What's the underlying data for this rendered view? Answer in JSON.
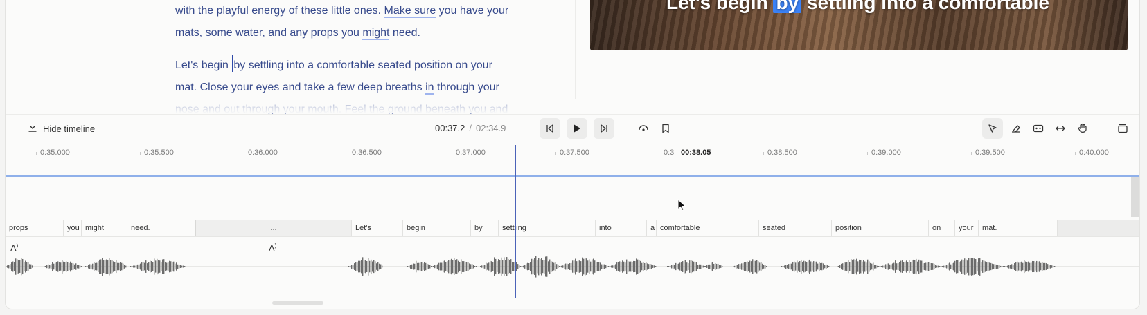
{
  "transcript": {
    "lines": [
      {
        "pre": "with the playful energy of these little ones. ",
        "ul": "Make sure",
        "post": " you have your"
      },
      {
        "pre": "mats, some water, and any props you ",
        "ul": "might",
        "post": " need."
      }
    ],
    "p2": {
      "l1_pre": "Let's begin ",
      "l1_post": "by settling into a comfortable seated position on your",
      "l2_pre": "mat. Close your eyes and take a few deep breaths ",
      "l2_ul": "in",
      "l2_post": " through your",
      "l3": "nose and out through your mouth. Feel the ground beneath you and"
    }
  },
  "video": {
    "caption_pre": "Let's begin ",
    "caption_hl": "by",
    "caption_post": " settling into a comfortable"
  },
  "toolbar": {
    "hide_timeline": "Hide timeline",
    "current_time": "00:37.2",
    "separator": "/",
    "total_time": "02:34.9",
    "icons": [
      "skip-back-icon",
      "play-icon",
      "skip-forward-icon",
      "loop-icon",
      "bookmark-icon",
      "select-tool-icon",
      "eraser-icon",
      "clip-icon",
      "stretch-icon",
      "hand-icon",
      "panel-icon"
    ]
  },
  "ruler": {
    "ticks": [
      "0:35.000",
      "0:35.500",
      "0:36.000",
      "0:36.500",
      "0:37.000",
      "0:37.500",
      "0:38.000",
      "0:38.500",
      "0:39.000",
      "0:39.500",
      "0:40.000"
    ],
    "clipped_tick": "0:3",
    "cursor_time": "00:38.05"
  },
  "words": [
    "props",
    "you",
    "might",
    "need.",
    "...",
    "Let's",
    "begin",
    "by",
    "settling",
    "into",
    "a",
    "comfortable",
    "seated",
    "position",
    "on",
    "your",
    "mat."
  ],
  "colors": {
    "accent": "#3b82f6",
    "transcript_text": "#374a8c",
    "playhead": "#4b63b8"
  }
}
